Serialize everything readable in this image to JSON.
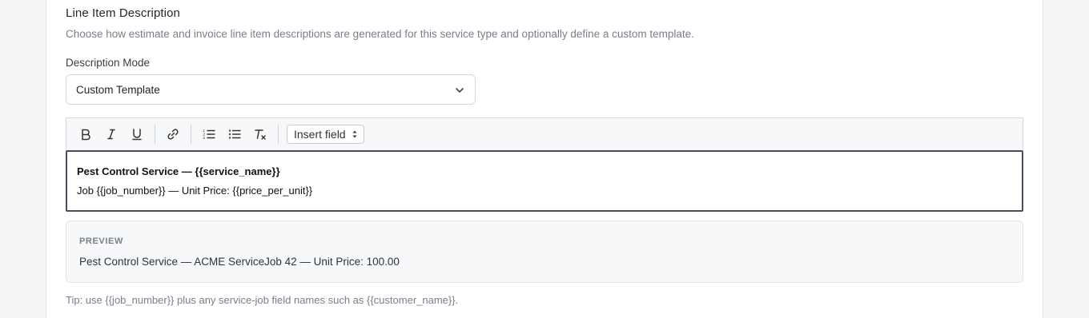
{
  "section": {
    "title": "Line Item Description",
    "description": "Choose how estimate and invoice line item descriptions are generated for this service type and optionally define a custom template."
  },
  "mode": {
    "label": "Description Mode",
    "selected": "Custom Template"
  },
  "toolbar": {
    "buttons": [
      "bold-icon",
      "italic-icon",
      "underline-icon",
      "link-icon",
      "ordered-list-icon",
      "bullet-list-icon",
      "clear-format-icon"
    ],
    "insert_field": "Insert field"
  },
  "editor": {
    "line1": "Pest Control Service — {{service_name}}",
    "line2": "Job {{job_number}} — Unit Price: {{price_per_unit}}"
  },
  "preview": {
    "label": "PREVIEW",
    "text": "Pest Control Service — ACME ServiceJob 42 — Unit Price: 100.00"
  },
  "tip": "Tip: use {{job_number}} plus any service-job field names such as {{customer_name}}."
}
